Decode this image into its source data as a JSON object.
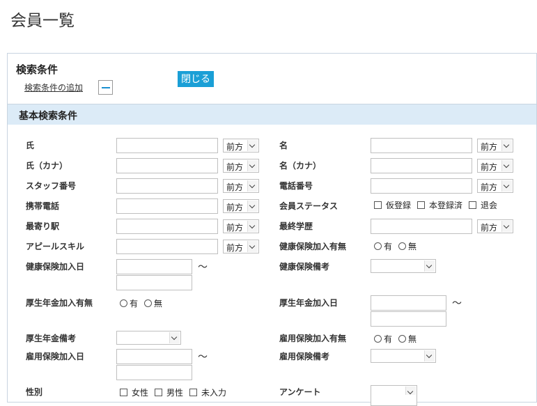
{
  "page": {
    "title": "会員一覧"
  },
  "panel": {
    "title": "検索条件",
    "add_condition_link": "検索条件の追加",
    "close_button": "閉じる",
    "section_title": "基本検索条件"
  },
  "match_mode": "前方",
  "tilde": "〜",
  "fields": {
    "last_name": "氏",
    "first_name": "名",
    "last_name_kana": "氏（カナ）",
    "first_name_kana": "名（カナ）",
    "staff_number": "スタッフ番号",
    "phone": "電話番号",
    "mobile": "携帯電話",
    "member_status": "会員ステータス",
    "nearest_station": "最寄り駅",
    "education": "最終学歴",
    "appeal_skill": "アピールスキル",
    "health_ins_flag": "健康保険加入有無",
    "health_ins_date": "健康保険加入日",
    "health_ins_note": "健康保険備考",
    "pension_flag": "厚生年金加入有無",
    "pension_date": "厚生年金加入日",
    "pension_note": "厚生年金備考",
    "employ_ins_flag": "雇用保険加入有無",
    "employ_ins_date": "雇用保険加入日",
    "employ_ins_note": "雇用保険備考",
    "gender": "性別",
    "survey": "アンケート"
  },
  "options": {
    "status": [
      "仮登録",
      "本登録済",
      "退会"
    ],
    "yes": "有",
    "no": "無",
    "gender": [
      "女性",
      "男性",
      "未入力"
    ]
  }
}
